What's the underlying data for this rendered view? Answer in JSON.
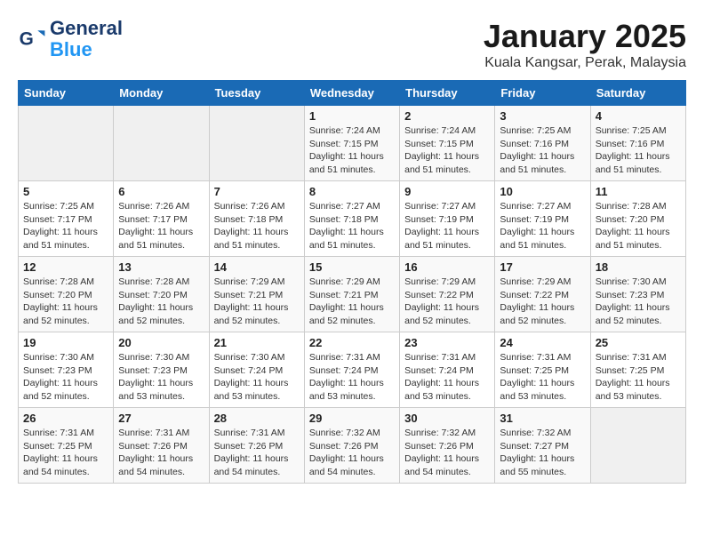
{
  "logo": {
    "line1": "General",
    "line2": "Blue"
  },
  "title": "January 2025",
  "subtitle": "Kuala Kangsar, Perak, Malaysia",
  "days_of_week": [
    "Sunday",
    "Monday",
    "Tuesday",
    "Wednesday",
    "Thursday",
    "Friday",
    "Saturday"
  ],
  "weeks": [
    [
      {
        "day": "",
        "sunrise": "",
        "sunset": "",
        "daylight": "",
        "empty": true
      },
      {
        "day": "",
        "sunrise": "",
        "sunset": "",
        "daylight": "",
        "empty": true
      },
      {
        "day": "",
        "sunrise": "",
        "sunset": "",
        "daylight": "",
        "empty": true
      },
      {
        "day": "1",
        "sunrise": "7:24 AM",
        "sunset": "7:15 PM",
        "daylight": "11 hours and 51 minutes."
      },
      {
        "day": "2",
        "sunrise": "7:24 AM",
        "sunset": "7:15 PM",
        "daylight": "11 hours and 51 minutes."
      },
      {
        "day": "3",
        "sunrise": "7:25 AM",
        "sunset": "7:16 PM",
        "daylight": "11 hours and 51 minutes."
      },
      {
        "day": "4",
        "sunrise": "7:25 AM",
        "sunset": "7:16 PM",
        "daylight": "11 hours and 51 minutes."
      }
    ],
    [
      {
        "day": "5",
        "sunrise": "7:25 AM",
        "sunset": "7:17 PM",
        "daylight": "11 hours and 51 minutes."
      },
      {
        "day": "6",
        "sunrise": "7:26 AM",
        "sunset": "7:17 PM",
        "daylight": "11 hours and 51 minutes."
      },
      {
        "day": "7",
        "sunrise": "7:26 AM",
        "sunset": "7:18 PM",
        "daylight": "11 hours and 51 minutes."
      },
      {
        "day": "8",
        "sunrise": "7:27 AM",
        "sunset": "7:18 PM",
        "daylight": "11 hours and 51 minutes."
      },
      {
        "day": "9",
        "sunrise": "7:27 AM",
        "sunset": "7:19 PM",
        "daylight": "11 hours and 51 minutes."
      },
      {
        "day": "10",
        "sunrise": "7:27 AM",
        "sunset": "7:19 PM",
        "daylight": "11 hours and 51 minutes."
      },
      {
        "day": "11",
        "sunrise": "7:28 AM",
        "sunset": "7:20 PM",
        "daylight": "11 hours and 51 minutes."
      }
    ],
    [
      {
        "day": "12",
        "sunrise": "7:28 AM",
        "sunset": "7:20 PM",
        "daylight": "11 hours and 52 minutes."
      },
      {
        "day": "13",
        "sunrise": "7:28 AM",
        "sunset": "7:20 PM",
        "daylight": "11 hours and 52 minutes."
      },
      {
        "day": "14",
        "sunrise": "7:29 AM",
        "sunset": "7:21 PM",
        "daylight": "11 hours and 52 minutes."
      },
      {
        "day": "15",
        "sunrise": "7:29 AM",
        "sunset": "7:21 PM",
        "daylight": "11 hours and 52 minutes."
      },
      {
        "day": "16",
        "sunrise": "7:29 AM",
        "sunset": "7:22 PM",
        "daylight": "11 hours and 52 minutes."
      },
      {
        "day": "17",
        "sunrise": "7:29 AM",
        "sunset": "7:22 PM",
        "daylight": "11 hours and 52 minutes."
      },
      {
        "day": "18",
        "sunrise": "7:30 AM",
        "sunset": "7:23 PM",
        "daylight": "11 hours and 52 minutes."
      }
    ],
    [
      {
        "day": "19",
        "sunrise": "7:30 AM",
        "sunset": "7:23 PM",
        "daylight": "11 hours and 52 minutes."
      },
      {
        "day": "20",
        "sunrise": "7:30 AM",
        "sunset": "7:23 PM",
        "daylight": "11 hours and 53 minutes."
      },
      {
        "day": "21",
        "sunrise": "7:30 AM",
        "sunset": "7:24 PM",
        "daylight": "11 hours and 53 minutes."
      },
      {
        "day": "22",
        "sunrise": "7:31 AM",
        "sunset": "7:24 PM",
        "daylight": "11 hours and 53 minutes."
      },
      {
        "day": "23",
        "sunrise": "7:31 AM",
        "sunset": "7:24 PM",
        "daylight": "11 hours and 53 minutes."
      },
      {
        "day": "24",
        "sunrise": "7:31 AM",
        "sunset": "7:25 PM",
        "daylight": "11 hours and 53 minutes."
      },
      {
        "day": "25",
        "sunrise": "7:31 AM",
        "sunset": "7:25 PM",
        "daylight": "11 hours and 53 minutes."
      }
    ],
    [
      {
        "day": "26",
        "sunrise": "7:31 AM",
        "sunset": "7:25 PM",
        "daylight": "11 hours and 54 minutes."
      },
      {
        "day": "27",
        "sunrise": "7:31 AM",
        "sunset": "7:26 PM",
        "daylight": "11 hours and 54 minutes."
      },
      {
        "day": "28",
        "sunrise": "7:31 AM",
        "sunset": "7:26 PM",
        "daylight": "11 hours and 54 minutes."
      },
      {
        "day": "29",
        "sunrise": "7:32 AM",
        "sunset": "7:26 PM",
        "daylight": "11 hours and 54 minutes."
      },
      {
        "day": "30",
        "sunrise": "7:32 AM",
        "sunset": "7:26 PM",
        "daylight": "11 hours and 54 minutes."
      },
      {
        "day": "31",
        "sunrise": "7:32 AM",
        "sunset": "7:27 PM",
        "daylight": "11 hours and 55 minutes."
      },
      {
        "day": "",
        "sunrise": "",
        "sunset": "",
        "daylight": "",
        "empty": true
      }
    ]
  ]
}
